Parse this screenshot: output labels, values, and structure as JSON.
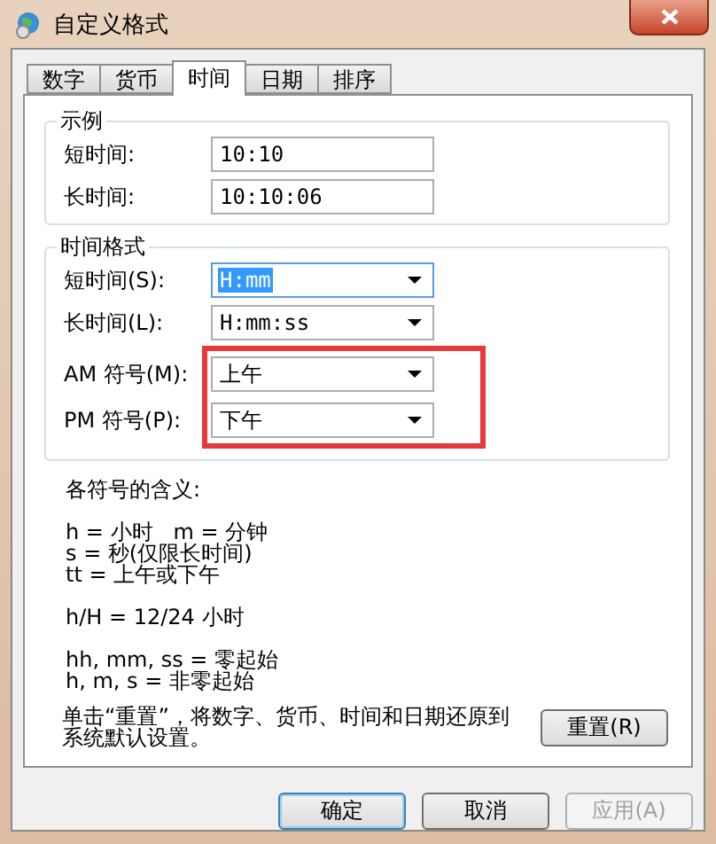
{
  "window": {
    "title": "自定义格式"
  },
  "tabs": [
    {
      "label": "数字",
      "selected": false
    },
    {
      "label": "货币",
      "selected": false
    },
    {
      "label": "时间",
      "selected": true
    },
    {
      "label": "日期",
      "selected": false
    },
    {
      "label": "排序",
      "selected": false
    }
  ],
  "sample": {
    "title": "示例",
    "rows": [
      {
        "label": "短时间:",
        "value": "10:10"
      },
      {
        "label": "长时间:",
        "value": "10:10:06"
      }
    ]
  },
  "format": {
    "title": "时间格式",
    "rows": [
      {
        "label": "短时间(S):",
        "value": "H:mm",
        "selected": true
      },
      {
        "label": "长时间(L):",
        "value": "H:mm:ss",
        "selected": false
      }
    ],
    "framed_rows": [
      {
        "label": "AM 符号(M):",
        "value": "上午",
        "selected": false
      },
      {
        "label": "PM 符号(P):",
        "value": "下午",
        "selected": false
      }
    ]
  },
  "legend": {
    "title": "各符号的含义:",
    "groups": [
      [
        "h = 小时   m = 分钟",
        "s = 秒(仅限长时间)",
        "tt = 上午或下午"
      ],
      [
        "h/H = 12/24 小时"
      ],
      [
        "hh, mm, ss = 零起始",
        "h, m, s = 非零起始"
      ]
    ]
  },
  "reset": {
    "note": "单击“重置”，将数字、货币、时间和日期还原到系统默认设置。",
    "button": "重置(R)"
  },
  "buttons": [
    {
      "label": "确定",
      "default": true,
      "disabled": false
    },
    {
      "label": "取消",
      "default": false,
      "disabled": false
    },
    {
      "label": "应用(A)",
      "default": false,
      "disabled": true
    }
  ]
}
